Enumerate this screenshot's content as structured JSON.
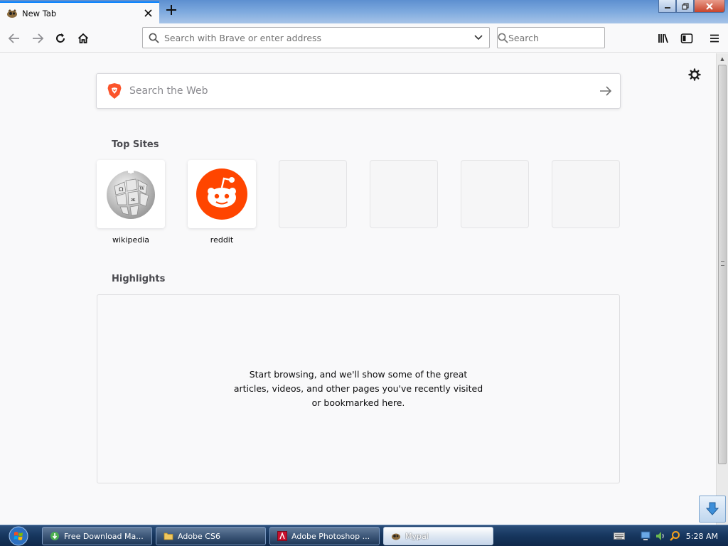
{
  "browser": {
    "tab": {
      "title": "New Tab",
      "favicon": "mypal-icon",
      "close_icon": "close-icon"
    },
    "new_tab_icon": "plus-icon",
    "window_controls": [
      "minimize-icon",
      "restore-icon",
      "close-icon"
    ]
  },
  "toolbar": {
    "nav_icons": [
      "back-icon",
      "forward-icon",
      "reload-icon",
      "home-icon"
    ],
    "urlbar": {
      "placeholder": "Search with Brave or enter address",
      "value": ""
    },
    "searchbar": {
      "placeholder": "Search",
      "value": ""
    },
    "right_icons": [
      "library-icon",
      "sidebar-icon",
      "menu-icon"
    ]
  },
  "newtab": {
    "websearch": {
      "placeholder": "Search the Web",
      "engine": "brave-logo"
    },
    "top_sites_title": "Top Sites",
    "top_sites": [
      {
        "label": "wikipedia",
        "icon": "wikipedia-globe"
      },
      {
        "label": "reddit",
        "icon": "reddit-logo"
      },
      {
        "label": ""
      },
      {
        "label": ""
      },
      {
        "label": ""
      },
      {
        "label": ""
      }
    ],
    "highlights_title": "Highlights",
    "highlights_empty": "Start browsing, and we'll show some of the great articles, videos, and other pages you've recently visited or bookmarked here."
  },
  "taskbar": {
    "items": [
      {
        "label": "Free Download Ma...",
        "icon": "fdm-icon"
      },
      {
        "label": "Adobe CS6",
        "icon": "folder-icon"
      },
      {
        "label": "Adobe Photoshop ...",
        "icon": "photoshop-icon"
      },
      {
        "label": "Mypal",
        "icon": "mypal-icon",
        "active": true
      }
    ],
    "clock": "5:28 AM"
  },
  "colors": {
    "accent": "#0a84ff",
    "reddit": "#ff4500",
    "brave": "#fb542b",
    "taskbar": "#16365e"
  }
}
